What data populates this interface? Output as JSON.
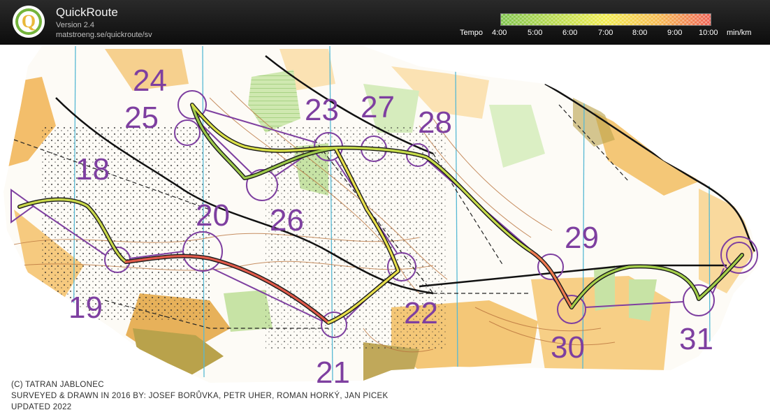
{
  "header": {
    "logo_letter": "Q",
    "title": "QuickRoute",
    "version": "Version 2.4",
    "url": "matstroeng.se/quickroute/sv"
  },
  "legend": {
    "label": "Tempo",
    "ticks": [
      "4:00",
      "5:00",
      "6:00",
      "7:00",
      "8:00",
      "9:00",
      "10:00"
    ],
    "unit": "min/km",
    "colors": [
      "#7dc34a",
      "#c8e04a",
      "#f2ec4c",
      "#f6b84a",
      "#ef5f52"
    ]
  },
  "controls": [
    {
      "number": "18"
    },
    {
      "number": "19"
    },
    {
      "number": "20"
    },
    {
      "number": "21"
    },
    {
      "number": "22"
    },
    {
      "number": "23"
    },
    {
      "number": "24"
    },
    {
      "number": "25"
    },
    {
      "number": "26"
    },
    {
      "number": "27"
    },
    {
      "number": "28"
    },
    {
      "number": "29"
    },
    {
      "number": "30"
    },
    {
      "number": "31"
    }
  ],
  "credits": {
    "copyright": "(C) TATRAN JABLONEC",
    "surveyed": "SURVEYED & DRAWN IN 2016 BY: JOSEF BORŮVKA, PETR UHER, ROMAN HORKÝ, JAN PICEK",
    "updated": "UPDATED 2022"
  },
  "colors": {
    "course_purple": "#7e3fa0",
    "open_land": "#f4c777",
    "rough_open": "#fbe2b3",
    "green": "#c7e3a5",
    "settlement": "#b9a24b",
    "water_line": "#57b9d4",
    "contour": "#b9733d"
  }
}
